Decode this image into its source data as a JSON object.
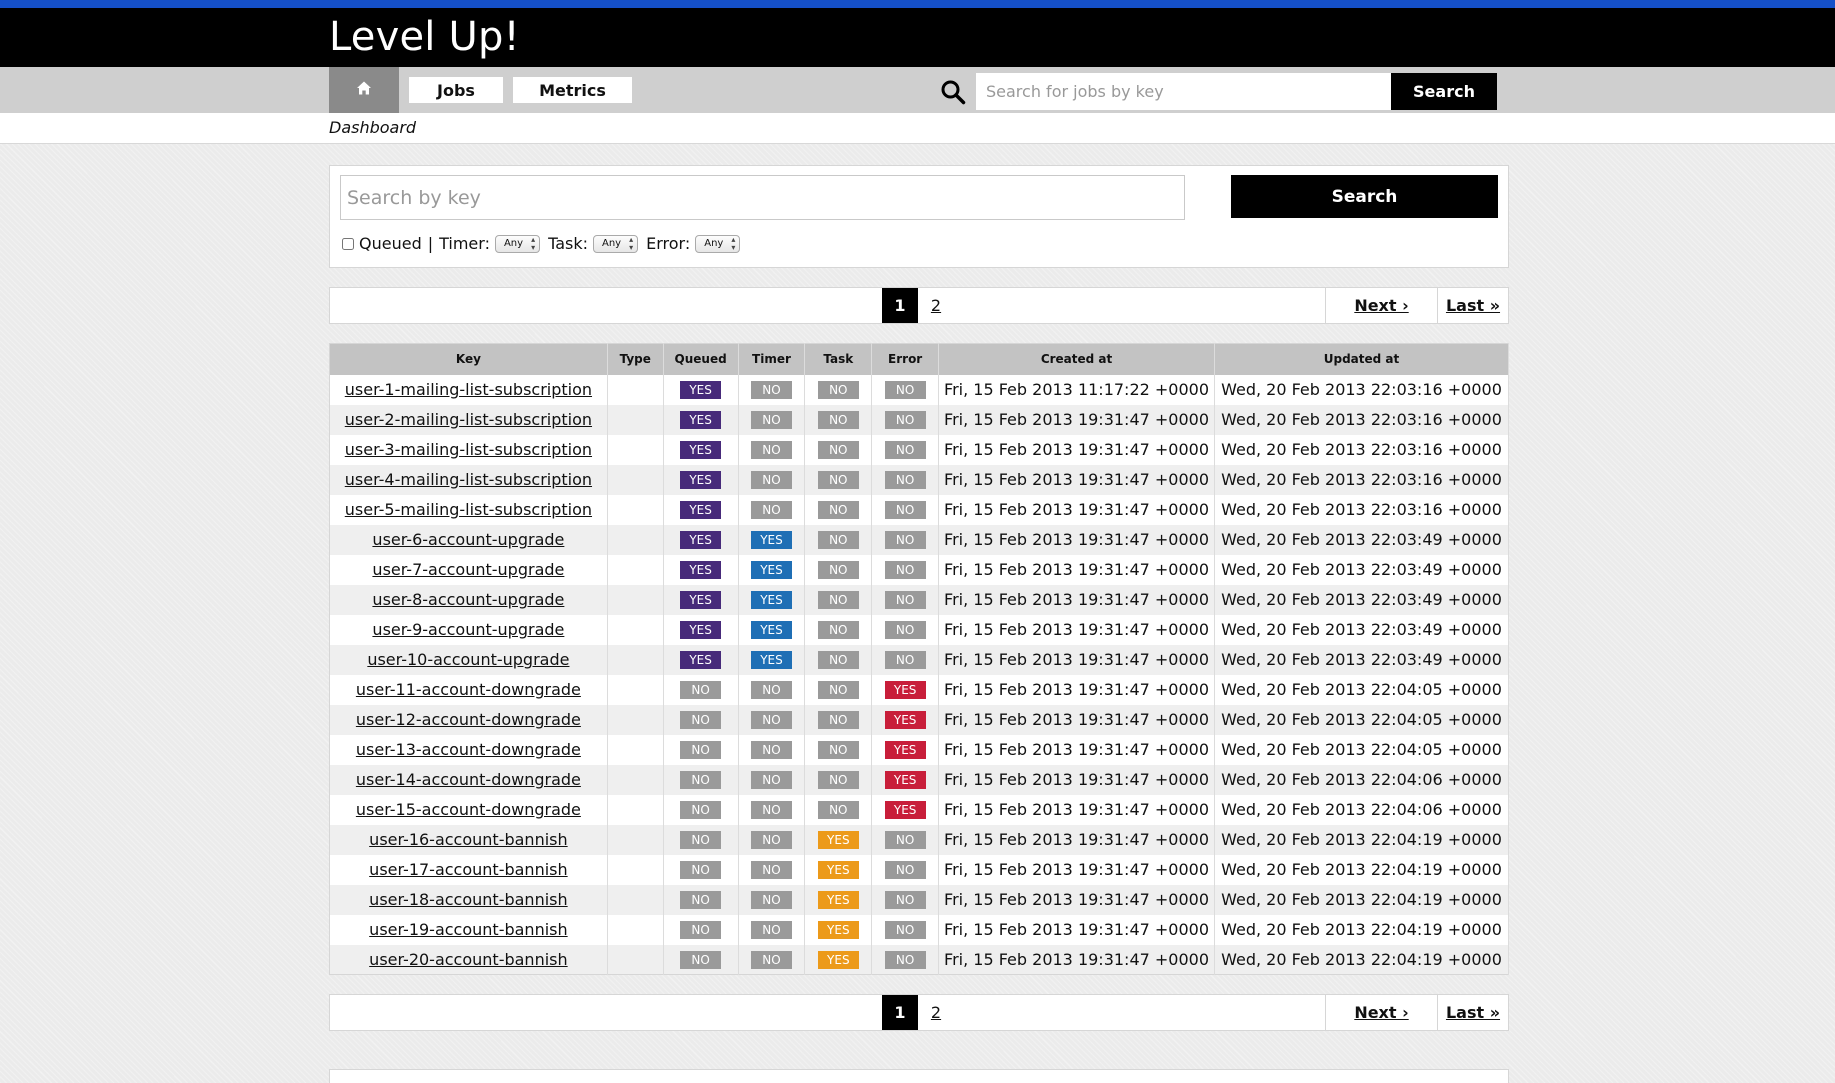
{
  "app": {
    "title": "Level Up!"
  },
  "nav": {
    "home_icon": "home-icon",
    "jobs_label": "Jobs",
    "metrics_label": "Metrics",
    "search_placeholder": "Search for jobs by key",
    "search_label": "Search"
  },
  "breadcrumb": {
    "label": "Dashboard"
  },
  "filter": {
    "key_placeholder": "Search by key",
    "search_label": "Search",
    "queued_label": "Queued",
    "separator": "|",
    "timer_label": "Timer:",
    "task_label": "Task:",
    "error_label": "Error:",
    "timer_value": "Any",
    "task_value": "Any",
    "error_value": "Any"
  },
  "pagination": {
    "pages": [
      "1",
      "2"
    ],
    "current": "1",
    "next_label": "Next ›",
    "last_label": "Last »"
  },
  "table": {
    "columns": [
      "Key",
      "Type",
      "Queued",
      "Timer",
      "Task",
      "Error",
      "Created at",
      "Updated at"
    ],
    "rows": [
      {
        "key": "user-1-mailing-list-subscription",
        "type": "",
        "queued": "YES",
        "timer": "NO",
        "task": "NO",
        "error": "NO",
        "created": "Fri, 15 Feb 2013 11:17:22 +0000",
        "updated": "Wed, 20 Feb 2013 22:03:16 +0000"
      },
      {
        "key": "user-2-mailing-list-subscription",
        "type": "",
        "queued": "YES",
        "timer": "NO",
        "task": "NO",
        "error": "NO",
        "created": "Fri, 15 Feb 2013 19:31:47 +0000",
        "updated": "Wed, 20 Feb 2013 22:03:16 +0000"
      },
      {
        "key": "user-3-mailing-list-subscription",
        "type": "",
        "queued": "YES",
        "timer": "NO",
        "task": "NO",
        "error": "NO",
        "created": "Fri, 15 Feb 2013 19:31:47 +0000",
        "updated": "Wed, 20 Feb 2013 22:03:16 +0000"
      },
      {
        "key": "user-4-mailing-list-subscription",
        "type": "",
        "queued": "YES",
        "timer": "NO",
        "task": "NO",
        "error": "NO",
        "created": "Fri, 15 Feb 2013 19:31:47 +0000",
        "updated": "Wed, 20 Feb 2013 22:03:16 +0000"
      },
      {
        "key": "user-5-mailing-list-subscription",
        "type": "",
        "queued": "YES",
        "timer": "NO",
        "task": "NO",
        "error": "NO",
        "created": "Fri, 15 Feb 2013 19:31:47 +0000",
        "updated": "Wed, 20 Feb 2013 22:03:16 +0000"
      },
      {
        "key": "user-6-account-upgrade",
        "type": "",
        "queued": "YES",
        "timer": "YES",
        "task": "NO",
        "error": "NO",
        "created": "Fri, 15 Feb 2013 19:31:47 +0000",
        "updated": "Wed, 20 Feb 2013 22:03:49 +0000"
      },
      {
        "key": "user-7-account-upgrade",
        "type": "",
        "queued": "YES",
        "timer": "YES",
        "task": "NO",
        "error": "NO",
        "created": "Fri, 15 Feb 2013 19:31:47 +0000",
        "updated": "Wed, 20 Feb 2013 22:03:49 +0000"
      },
      {
        "key": "user-8-account-upgrade",
        "type": "",
        "queued": "YES",
        "timer": "YES",
        "task": "NO",
        "error": "NO",
        "created": "Fri, 15 Feb 2013 19:31:47 +0000",
        "updated": "Wed, 20 Feb 2013 22:03:49 +0000"
      },
      {
        "key": "user-9-account-upgrade",
        "type": "",
        "queued": "YES",
        "timer": "YES",
        "task": "NO",
        "error": "NO",
        "created": "Fri, 15 Feb 2013 19:31:47 +0000",
        "updated": "Wed, 20 Feb 2013 22:03:49 +0000"
      },
      {
        "key": "user-10-account-upgrade",
        "type": "",
        "queued": "YES",
        "timer": "YES",
        "task": "NO",
        "error": "NO",
        "created": "Fri, 15 Feb 2013 19:31:47 +0000",
        "updated": "Wed, 20 Feb 2013 22:03:49 +0000"
      },
      {
        "key": "user-11-account-downgrade",
        "type": "",
        "queued": "NO",
        "timer": "NO",
        "task": "NO",
        "error": "YES",
        "created": "Fri, 15 Feb 2013 19:31:47 +0000",
        "updated": "Wed, 20 Feb 2013 22:04:05 +0000"
      },
      {
        "key": "user-12-account-downgrade",
        "type": "",
        "queued": "NO",
        "timer": "NO",
        "task": "NO",
        "error": "YES",
        "created": "Fri, 15 Feb 2013 19:31:47 +0000",
        "updated": "Wed, 20 Feb 2013 22:04:05 +0000"
      },
      {
        "key": "user-13-account-downgrade",
        "type": "",
        "queued": "NO",
        "timer": "NO",
        "task": "NO",
        "error": "YES",
        "created": "Fri, 15 Feb 2013 19:31:47 +0000",
        "updated": "Wed, 20 Feb 2013 22:04:05 +0000"
      },
      {
        "key": "user-14-account-downgrade",
        "type": "",
        "queued": "NO",
        "timer": "NO",
        "task": "NO",
        "error": "YES",
        "created": "Fri, 15 Feb 2013 19:31:47 +0000",
        "updated": "Wed, 20 Feb 2013 22:04:06 +0000"
      },
      {
        "key": "user-15-account-downgrade",
        "type": "",
        "queued": "NO",
        "timer": "NO",
        "task": "NO",
        "error": "YES",
        "created": "Fri, 15 Feb 2013 19:31:47 +0000",
        "updated": "Wed, 20 Feb 2013 22:04:06 +0000"
      },
      {
        "key": "user-16-account-bannish",
        "type": "",
        "queued": "NO",
        "timer": "NO",
        "task": "YES",
        "error": "NO",
        "created": "Fri, 15 Feb 2013 19:31:47 +0000",
        "updated": "Wed, 20 Feb 2013 22:04:19 +0000"
      },
      {
        "key": "user-17-account-bannish",
        "type": "",
        "queued": "NO",
        "timer": "NO",
        "task": "YES",
        "error": "NO",
        "created": "Fri, 15 Feb 2013 19:31:47 +0000",
        "updated": "Wed, 20 Feb 2013 22:04:19 +0000"
      },
      {
        "key": "user-18-account-bannish",
        "type": "",
        "queued": "NO",
        "timer": "NO",
        "task": "YES",
        "error": "NO",
        "created": "Fri, 15 Feb 2013 19:31:47 +0000",
        "updated": "Wed, 20 Feb 2013 22:04:19 +0000"
      },
      {
        "key": "user-19-account-bannish",
        "type": "",
        "queued": "NO",
        "timer": "NO",
        "task": "YES",
        "error": "NO",
        "created": "Fri, 15 Feb 2013 19:31:47 +0000",
        "updated": "Wed, 20 Feb 2013 22:04:19 +0000"
      },
      {
        "key": "user-20-account-bannish",
        "type": "",
        "queued": "NO",
        "timer": "NO",
        "task": "YES",
        "error": "NO",
        "created": "Fri, 15 Feb 2013 19:31:47 +0000",
        "updated": "Wed, 20 Feb 2013 22:04:19 +0000"
      }
    ]
  },
  "colors": {
    "accent_bar": "#1550c8",
    "queued_yes": "#472a7a",
    "timer_yes": "#1f6fb5",
    "task_yes": "#ec9a1a",
    "error_yes": "#c81e3a",
    "no": "#9a9a9a"
  }
}
